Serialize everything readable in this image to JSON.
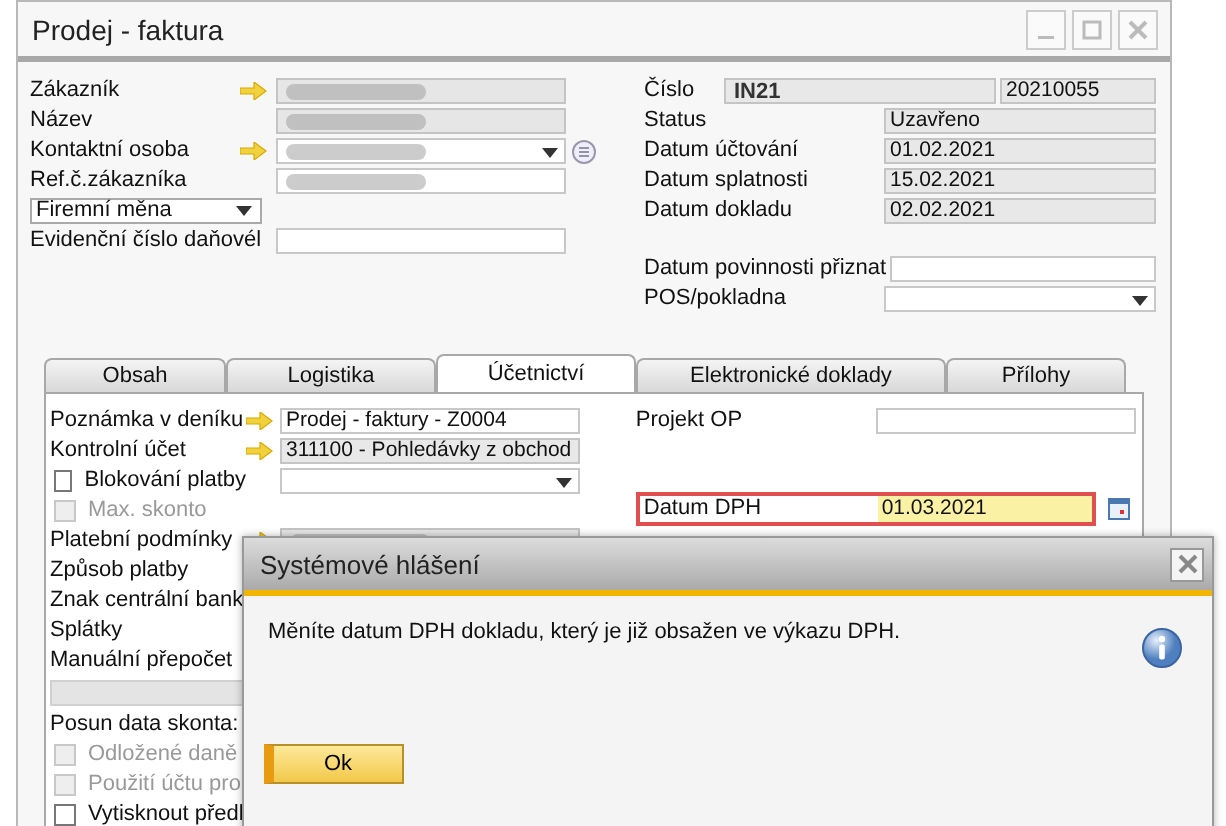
{
  "window": {
    "title": "Prodej - faktura"
  },
  "header_left": [
    {
      "label": "Zákazník",
      "kind": "field",
      "link_arrow": true,
      "field": {
        "kind": "readonly",
        "blurred": true
      }
    },
    {
      "label": "Název",
      "kind": "field",
      "field": {
        "kind": "readonly",
        "blurred": true
      }
    },
    {
      "label": "Kontaktní osoba",
      "kind": "field",
      "link_arrow": true,
      "field": {
        "kind": "dropdown",
        "blurred": true
      },
      "list_button": true
    },
    {
      "label": "Ref.č.zákazníka",
      "kind": "field",
      "field": {
        "kind": "text",
        "blurred": true
      }
    },
    {
      "label": "Firemní měna",
      "kind": "label_select"
    },
    {
      "label": "Evidenční číslo daňovél",
      "kind": "field",
      "field": {
        "kind": "text"
      }
    }
  ],
  "header_right": [
    {
      "label": "Číslo",
      "kind": "series",
      "series": "IN21",
      "field": {
        "kind": "readonly",
        "value": "20210055"
      }
    },
    {
      "label": "Status",
      "kind": "field",
      "field": {
        "kind": "readonly",
        "value": "Uzavřeno"
      }
    },
    {
      "label": "Datum účtování",
      "kind": "field",
      "field": {
        "kind": "readonly",
        "value": "01.02.2021"
      }
    },
    {
      "label": "Datum splatnosti",
      "kind": "field",
      "field": {
        "kind": "readonly",
        "value": "15.02.2021"
      }
    },
    {
      "label": "Datum dokladu",
      "kind": "field",
      "field": {
        "kind": "readonly",
        "value": "02.02.2021"
      }
    },
    {
      "kind": "gap"
    },
    {
      "label": "Datum povinnosti přiznat",
      "kind": "field",
      "field": {
        "kind": "text"
      }
    },
    {
      "label": "POS/pokladna",
      "kind": "field",
      "field": {
        "kind": "dropdown"
      }
    }
  ],
  "tabs": [
    {
      "label": "Obsah",
      "selected": false
    },
    {
      "label": "Logistika",
      "selected": false
    },
    {
      "label": "Účetnictví",
      "selected": true
    },
    {
      "label": "Elektronické doklady",
      "selected": false
    },
    {
      "label": "Přílohy",
      "selected": false
    }
  ],
  "panel_left": [
    {
      "label": "Poznámka v deníku",
      "kind": "field",
      "link_arrow": true,
      "field": {
        "kind": "text",
        "value": "Prodej - faktury - Z0004"
      }
    },
    {
      "label": "Kontrolní účet",
      "kind": "field",
      "link_arrow": true,
      "field": {
        "kind": "readonly",
        "value": "311100 - Pohledávky z obchod"
      }
    },
    {
      "label": "Blokování platby",
      "kind": "checkbox",
      "checked": false,
      "disabled": false,
      "field": {
        "kind": "dropdown"
      }
    },
    {
      "label": "Max. skonto",
      "kind": "checkbox",
      "checked": false,
      "disabled": true
    },
    {
      "label": "Platební podmínky",
      "kind": "field",
      "link_arrow": true,
      "field": {
        "kind": "readonly",
        "blurred": true
      }
    },
    {
      "label": "Způsob platby",
      "kind": "label"
    },
    {
      "label": "Znak centrální bank",
      "kind": "label"
    },
    {
      "label": "Splátky",
      "kind": "label"
    },
    {
      "label": "Manuální přepočet",
      "kind": "label"
    },
    {
      "kind": "bar"
    },
    {
      "label": "Posun data skonta:",
      "kind": "label"
    },
    {
      "label": "Odložené daně",
      "kind": "checkbox",
      "checked": false,
      "disabled": true
    },
    {
      "label": "Použití účtu pro",
      "kind": "checkbox",
      "checked": false,
      "disabled": true
    },
    {
      "label": "Vytisknout předl",
      "kind": "checkbox",
      "checked": false,
      "disabled": false
    }
  ],
  "panel_right": [
    {
      "label": "Projekt OP",
      "kind": "field",
      "field": {
        "kind": "text"
      }
    },
    {
      "kind": "gap"
    },
    {
      "label": "Datum DPH",
      "kind": "date",
      "highlighted": true,
      "field": {
        "kind": "focused",
        "value": "01.03.2021"
      }
    }
  ],
  "dialog": {
    "title": "Systémové hlášení",
    "message": "Měníte datum DPH dokladu, který je již obsažen ve výkazu DPH.",
    "buttons": [
      "Ok"
    ]
  }
}
